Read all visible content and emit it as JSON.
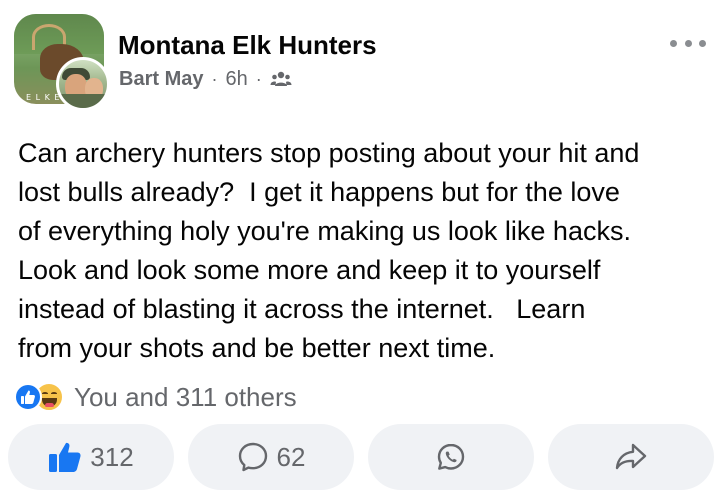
{
  "post": {
    "group_name": "Montana Elk Hunters",
    "author": "Bart May",
    "separator": "·",
    "time": "6h",
    "audience_icon": "members-icon",
    "group_avatar_caption": "E L K E",
    "more_icon": "more-options-icon",
    "text": "Can archery hunters stop posting about your hit and\nlost bulls already?  I get it happens but for the love\nof everything holy you're making us look like hacks.\nLook and look some more and keep it to yourself\ninstead of blasting it across the internet.   Learn\nfrom your shots and be better next time."
  },
  "reactions": {
    "icons": [
      "like-reaction-icon",
      "haha-reaction-icon"
    ],
    "summary": "You and 311 others"
  },
  "actions": {
    "like_count": "312",
    "comment_count": "62",
    "whatsapp_icon": "whatsapp-icon",
    "share_icon": "share-icon"
  },
  "colors": {
    "like_blue": "#1877f2",
    "secondary_text": "#65676b",
    "button_bg": "#f0f2f5"
  }
}
